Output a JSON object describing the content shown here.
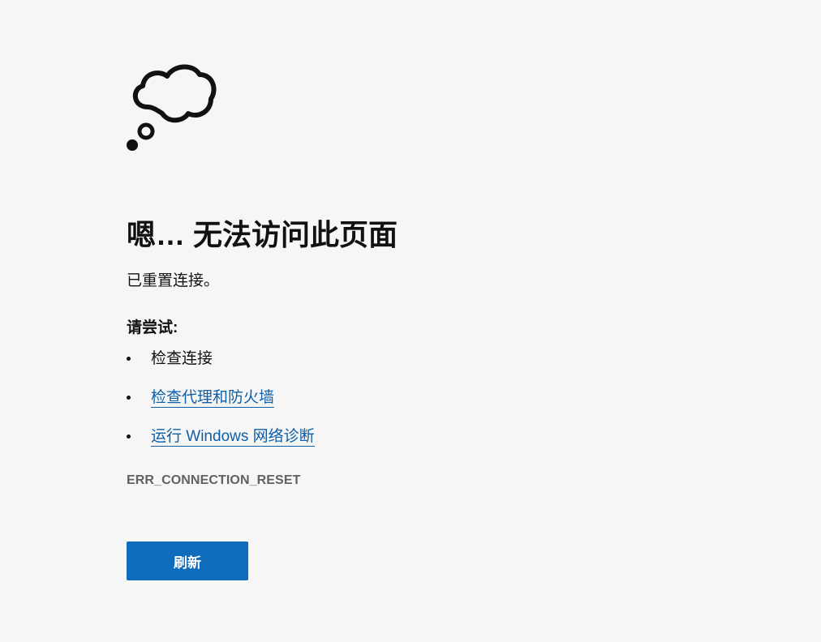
{
  "icon": {
    "name": "thought-cloud-icon"
  },
  "error_page": {
    "title": "嗯… 无法访问此页面",
    "message": "已重置连接。",
    "try_heading": "请尝试:",
    "suggestions": [
      {
        "label": "检查连接",
        "is_link": false
      },
      {
        "label": "检查代理和防火墙",
        "is_link": true
      },
      {
        "label": "运行 Windows 网络诊断",
        "is_link": true
      }
    ],
    "error_code": "ERR_CONNECTION_RESET",
    "refresh_label": "刷新"
  },
  "colors": {
    "background": "#f6f6f6",
    "link": "#0f5fa8",
    "button": "#0f6cbd",
    "error_code": "#616161"
  }
}
